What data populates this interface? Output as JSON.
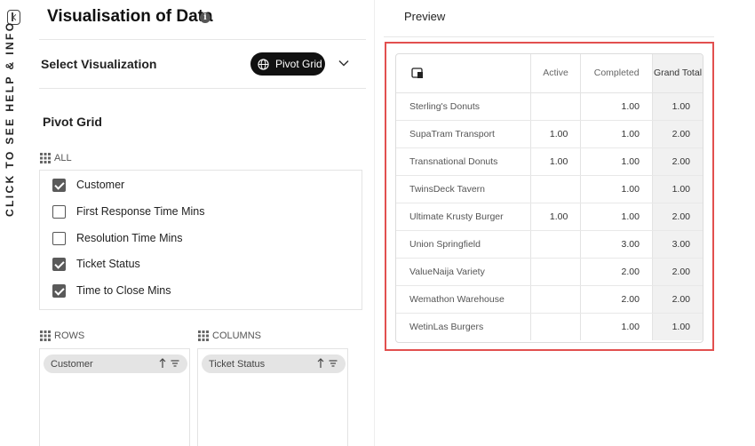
{
  "help": {
    "label": "CLICK TO SEE HELP & INFO"
  },
  "header": {
    "title": "Visualisation of Data",
    "info_icon": "info-icon"
  },
  "visualization": {
    "label": "Select Visualization",
    "selected": "Pivot Grid"
  },
  "pivot": {
    "title": "Pivot Grid",
    "all_label": "ALL",
    "fields": [
      {
        "label": "Customer",
        "checked": true
      },
      {
        "label": "First Response Time Mins",
        "checked": false
      },
      {
        "label": "Resolution Time Mins",
        "checked": false
      },
      {
        "label": "Ticket Status",
        "checked": true
      },
      {
        "label": "Time to Close Mins",
        "checked": true
      }
    ],
    "rows_label": "ROWS",
    "columns_label": "COLUMNS",
    "row_chip": "Customer",
    "column_chip": "Ticket Status"
  },
  "preview": {
    "label": "Preview",
    "headers": [
      "Active",
      "Completed",
      "Grand Total"
    ],
    "rows": [
      {
        "name": "Sterling's Donuts",
        "active": "",
        "completed": "1.00",
        "total": "1.00"
      },
      {
        "name": "SupaTram Transport",
        "active": "1.00",
        "completed": "1.00",
        "total": "2.00"
      },
      {
        "name": "Transnational Donuts",
        "active": "1.00",
        "completed": "1.00",
        "total": "2.00"
      },
      {
        "name": "TwinsDeck Tavern",
        "active": "",
        "completed": "1.00",
        "total": "1.00"
      },
      {
        "name": "Ultimate Krusty Burger",
        "active": "1.00",
        "completed": "1.00",
        "total": "2.00"
      },
      {
        "name": "Union Springfield",
        "active": "",
        "completed": "3.00",
        "total": "3.00"
      },
      {
        "name": "ValueNaija Variety",
        "active": "",
        "completed": "2.00",
        "total": "2.00"
      },
      {
        "name": "Wemathon Warehouse",
        "active": "",
        "completed": "2.00",
        "total": "2.00"
      },
      {
        "name": "WetinLas Burgers",
        "active": "",
        "completed": "1.00",
        "total": "1.00"
      }
    ]
  },
  "colors": {
    "highlight_border": "#e2504f",
    "button_bg": "#111111"
  }
}
